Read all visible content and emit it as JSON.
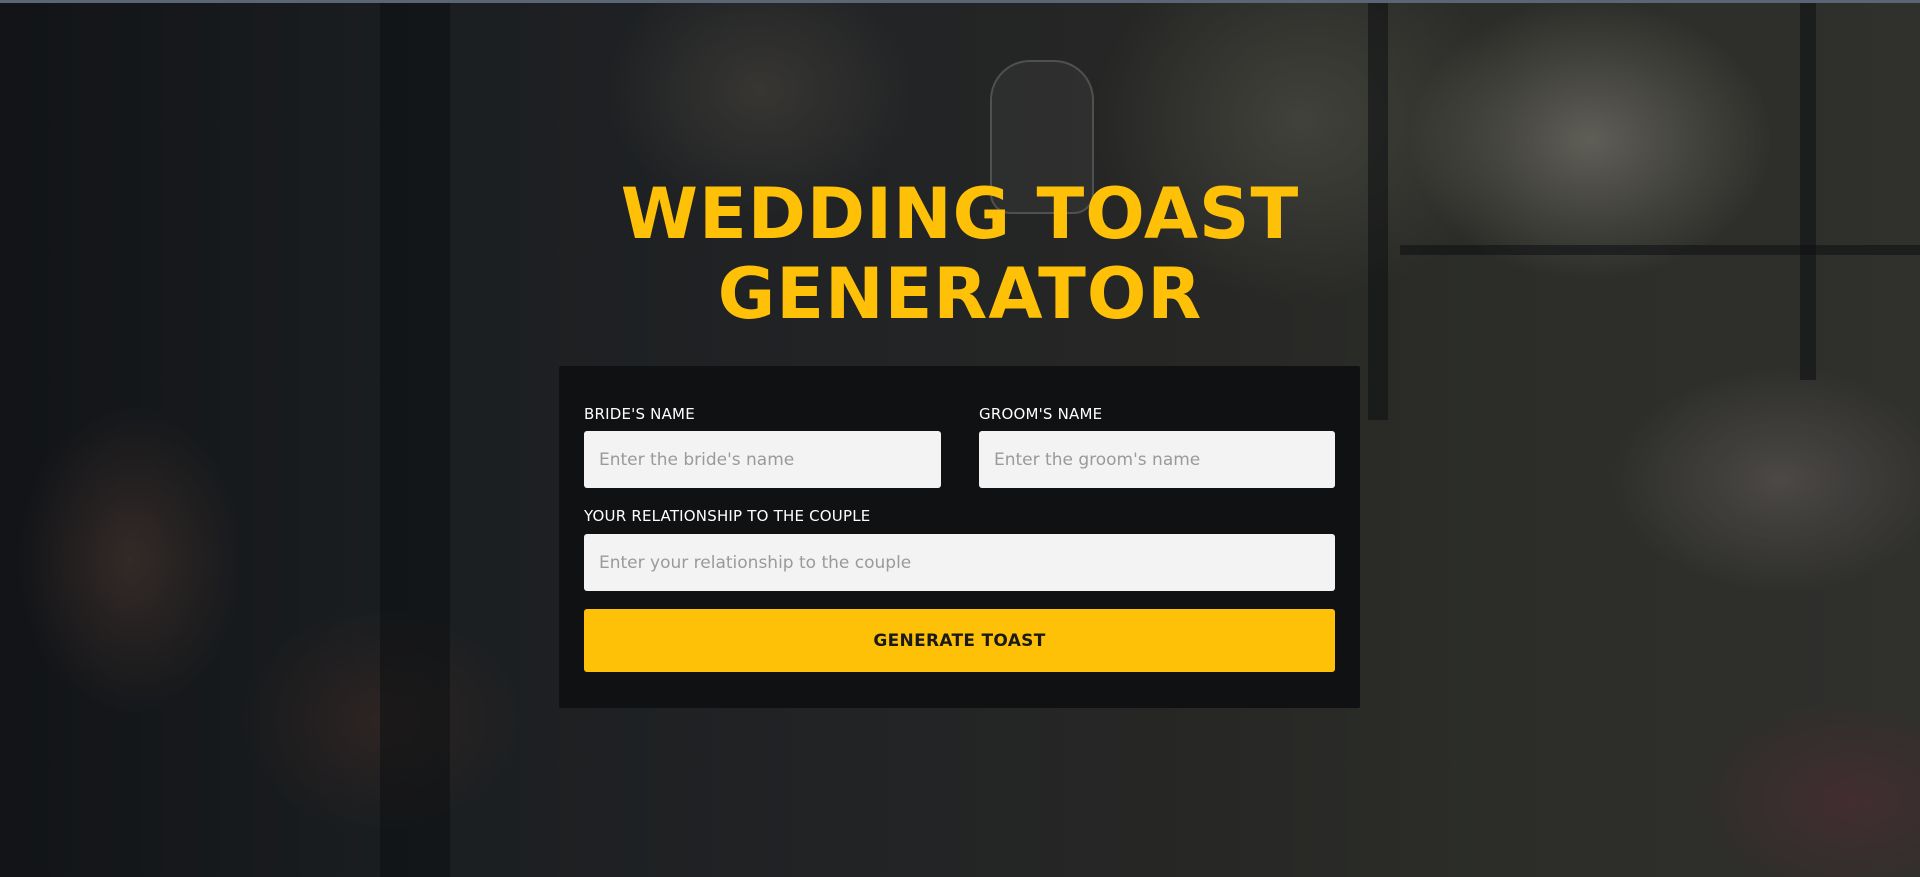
{
  "page": {
    "title_line1": "WEDDING TOAST",
    "title_line2": "GENERATOR",
    "accent_color": "#ffc107",
    "card_color": "#101113"
  },
  "form": {
    "bride": {
      "label": "BRIDE'S NAME",
      "value": "",
      "placeholder": "Enter the bride's name"
    },
    "groom": {
      "label": "GROOM'S NAME",
      "value": "",
      "placeholder": "Enter the groom's name"
    },
    "relationship": {
      "label": "YOUR RELATIONSHIP TO THE COUPLE",
      "value": "",
      "placeholder": "Enter your relationship to the couple"
    },
    "submit_label": "GENERATE TOAST"
  }
}
